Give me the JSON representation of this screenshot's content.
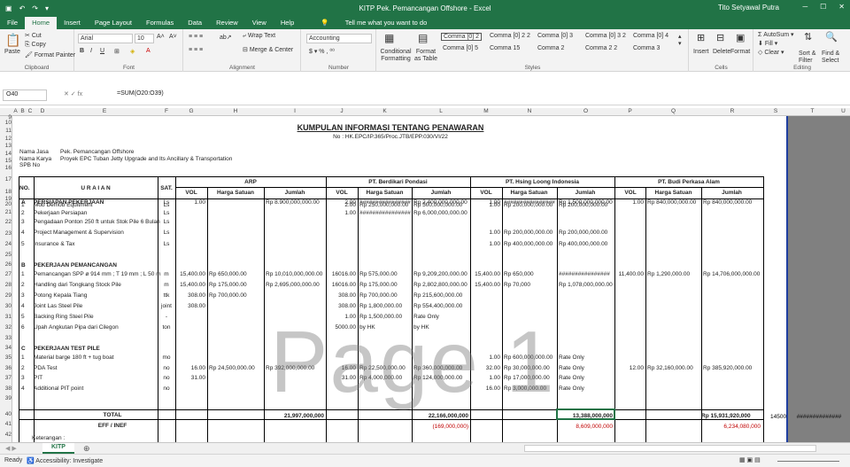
{
  "titlebar": {
    "title": "KITP Pek. Pemancangan Offshore  -  Excel",
    "user": "Tito Setyawal Putra"
  },
  "tabs": [
    "File",
    "Home",
    "Insert",
    "Page Layout",
    "Formulas",
    "Data",
    "Review",
    "View",
    "Help"
  ],
  "tellme": "Tell me what you want to do",
  "ribbon": {
    "clipboard": {
      "paste": "Paste",
      "cut": "Cut",
      "copy": "Copy",
      "painter": "Format Painter",
      "label": "Clipboard"
    },
    "font": {
      "name": "Arial",
      "size": "10",
      "label": "Font"
    },
    "alignment": {
      "wrap": "Wrap Text",
      "merge": "Merge & Center",
      "label": "Alignment"
    },
    "number": {
      "format": "Accounting",
      "label": "Number"
    },
    "styles": {
      "cond": "Conditional Formatting",
      "table": "Format as Table",
      "cells": [
        "Comma [0] 2",
        "Comma [0] 2 2",
        "Comma [0] 3",
        "Comma [0] 3 2",
        "Comma [0] 4",
        "Comma [0] 5",
        "Comma 15",
        "Comma 2",
        "Comma 2 2",
        "Comma 3"
      ],
      "label": "Styles"
    },
    "cells": {
      "insert": "Insert",
      "delete": "Delete",
      "format": "Format",
      "label": "Cells"
    },
    "editing": {
      "autosum": "AutoSum",
      "fill": "Fill",
      "clear": "Clear",
      "sort": "Sort & Filter",
      "find": "Find & Select",
      "label": "Editing"
    }
  },
  "formulabar": {
    "namebox": "O40",
    "formula": "=SUM(O20:O39)"
  },
  "columns": [
    "A",
    "B",
    "C",
    "D",
    "E",
    "F",
    "G",
    "H",
    "I",
    "J",
    "K",
    "L",
    "M",
    "N",
    "O",
    "P",
    "Q",
    "R",
    "S",
    "T",
    "U"
  ],
  "rows": [
    "9",
    "10",
    "11",
    "12",
    "13",
    "14",
    "15",
    "16",
    "17",
    "18",
    "19",
    "20",
    "21",
    "22",
    "23",
    "24",
    "25",
    "26",
    "27",
    "28",
    "29",
    "30",
    "31",
    "32",
    "33",
    "34",
    "35",
    "36",
    "37",
    "38",
    "39",
    "40",
    "41",
    "42"
  ],
  "doc": {
    "title": "KUMPULAN INFORMASI TENTANG PENAWARAN",
    "nomor": "No : HK.EPC/IP.365/Proc.JTB/EPP.030/VI/22",
    "nama_jasa_label": "Nama Jasa",
    "nama_jasa": "Pek. Pemancangan Offshore",
    "nama_karya_label": "Nama Karya",
    "nama_karya": "Proyek EPC Tuban Jetty Upgrade and Its Ancillary & Transportation",
    "spb_label": "SPB No",
    "no": "NO.",
    "uraian": "U R A I A N",
    "sat": "SAT.",
    "vendors": [
      "ARP",
      "PT. Berdikari Pondasi",
      "PT. Hsing Loong Indonesia",
      "PT. Budi Perkasa Alam"
    ],
    "vol": "VOL",
    "harga": "Harga Satuan",
    "jumlah": "Jumlah",
    "total_label": "TOTAL",
    "eff_label": "EFF / INEF",
    "keterangan": "Keterangan :",
    "extra_s40": "14500",
    "extra_t40": "##############"
  },
  "items": [
    {
      "no": "A",
      "desc": "PERSIAPAN PEKERJAAN",
      "sat": "Ls",
      "v1": "1.00",
      "h1": "",
      "j1": "Rp  8.900,000,000.00",
      "v2": "2.00",
      "h2": "################",
      "j2": "Rp  2,400,000,000.00",
      "v3": "1.00",
      "h3": "################",
      "j3": "Rp 1,500,000,000.00",
      "v4": "1.00",
      "h4": "Rp  840,000,000.00",
      "j4": "Rp         840,000,000.00",
      "bold": true
    },
    {
      "no": "1",
      "desc": "Mob Demob Equitment",
      "sat": "Ls",
      "v2": "2.00",
      "h2": "Rp 250,000,000.00",
      "j2": "Rp      500,000,000.00",
      "v3": "1.00",
      "h3": "Rp  200,000,000.00",
      "j3": "Rp  200,000,000.00"
    },
    {
      "no": "2",
      "desc": "Pekerjaan Persiapan",
      "sat": "Ls",
      "v2": "1.00",
      "h2": "################",
      "j2": "Rp  6,000,000,000.00"
    },
    {
      "no": "3",
      "desc": "Pengadaan Ponton 250 ft untuk Stok Pile 6 Bulan",
      "sat": "Ls"
    },
    {
      "no": "4",
      "desc": "Project Management & Supervision",
      "sat": "Ls",
      "v3": "1.00",
      "h3": "Rp  200,000,000.00",
      "j3": "Rp  200,000,000.00"
    },
    {
      "no": "5",
      "desc": "Insurance & Tax",
      "sat": "Ls",
      "v3": "1.00",
      "h3": "Rp  400,000,000.00",
      "j3": "Rp  400,000,000.00"
    },
    {
      "no": "B",
      "desc": "PEKERJAAN PEMANCANGAN",
      "bold": true
    },
    {
      "no": "1",
      "desc": "Pemancangan SPP ø 914 mm ; T 19 mm ; L 50 m",
      "sat": "m",
      "v1": "15,400.00",
      "h1": "Rp        650,000.00",
      "j1": "Rp  10,010,000,000.00",
      "v2": "16016.00",
      "h2": "Rp        575,000.00",
      "j2": "Rp  9,209,200,000.00",
      "v3": "15,400.00",
      "h3": "Rp              650,000",
      "j3": "################",
      "v4": "11,400.00",
      "h4": "Rp    1,290,000.00",
      "j4": "Rp  14,706,000,000.00"
    },
    {
      "no": "2",
      "desc": "Handling dari Tongkang Stock Pile",
      "sat": "m",
      "v1": "15,400.00",
      "h1": "Rp        175,000.00",
      "j1": "Rp  2,695,000,000.00",
      "v2": "16016.00",
      "h2": "Rp        175,000.00",
      "j2": "Rp  2,802,800,000.00",
      "v3": "15,400.00",
      "h3": "Rp                70,000",
      "j3": "Rp 1,078,000,000.00"
    },
    {
      "no": "3",
      "desc": "Potong Kepala Tiang",
      "sat": "ttk",
      "v1": "308.00",
      "h1": "Rp        700,000.00",
      "v2": "308.00",
      "h2": "Rp        700,000.00",
      "j2": "Rp      215,600,000.00"
    },
    {
      "no": "4",
      "desc": "Joint Las Steel Pile",
      "sat": "joint",
      "v1": "308.00",
      "v2": "308.00",
      "h2": "Rp     1,800,000.00",
      "j2": "Rp      554,400,000.00"
    },
    {
      "no": "5",
      "desc": "Backing Ring Steel Pile",
      "sat": "-",
      "v2": "1.00",
      "h2": "Rp     1,500,000.00",
      "j2": "Rate Only"
    },
    {
      "no": "6",
      "desc": "Upah Angkutan Pipa dari Cilegon",
      "sat": "ton",
      "v2": "5000.00",
      "h2": "by HK",
      "j2": "by HK"
    },
    {
      "no": "C",
      "desc": "PEKERJAAN TEST PILE",
      "bold": true
    },
    {
      "no": "1",
      "desc": "Material barge 180 ft + tug boat",
      "sat": "mo",
      "v3": "1.00",
      "h3": "Rp  600,000,000.00",
      "j3": "Rate Only"
    },
    {
      "no": "2",
      "desc": "PDA Test",
      "sat": "no",
      "v1": "16.00",
      "h1": "Rp     24,500,000.00",
      "j1": "Rp      392,000,000.00",
      "v2": "16.00",
      "h2": "Rp    22,500,000.00",
      "j2": "Rp      360,000,000.00",
      "v3": "32.00",
      "h3": "Rp    30,000,000.00",
      "j3": "Rate Only",
      "v4": "12.00",
      "h4": "Rp    32,160,000.00",
      "j4": "Rp         385,920,000.00"
    },
    {
      "no": "3",
      "desc": "PIT",
      "sat": "no",
      "v1": "31.00",
      "v2": "31.00",
      "h2": "Rp     4,000,000.00",
      "j2": "Rp      124,000,000.00",
      "v3": "1.00",
      "h3": "Rp    17,000,000.00",
      "j3": "Rate Only"
    },
    {
      "no": "4",
      "desc": "Additional PIT point",
      "sat": "no",
      "v3": "16.00",
      "h3": "Rp      3,000,000.00",
      "j3": "Rate Only"
    }
  ],
  "totals": {
    "arp": "21,997,000,000",
    "berdikari": "22,166,000,000",
    "hsing": "13,388,000,000",
    "budi": "Rp       15,931,920,000"
  },
  "eff": {
    "berdikari": "(169,000,000)",
    "hsing": "8,609,000,000",
    "budi": "6,234,080,000"
  },
  "sheet": {
    "tab": "KITP"
  },
  "status": {
    "ready": "Ready",
    "accessibility": "Accessibility: Investigate"
  },
  "watermark": "Page 1"
}
